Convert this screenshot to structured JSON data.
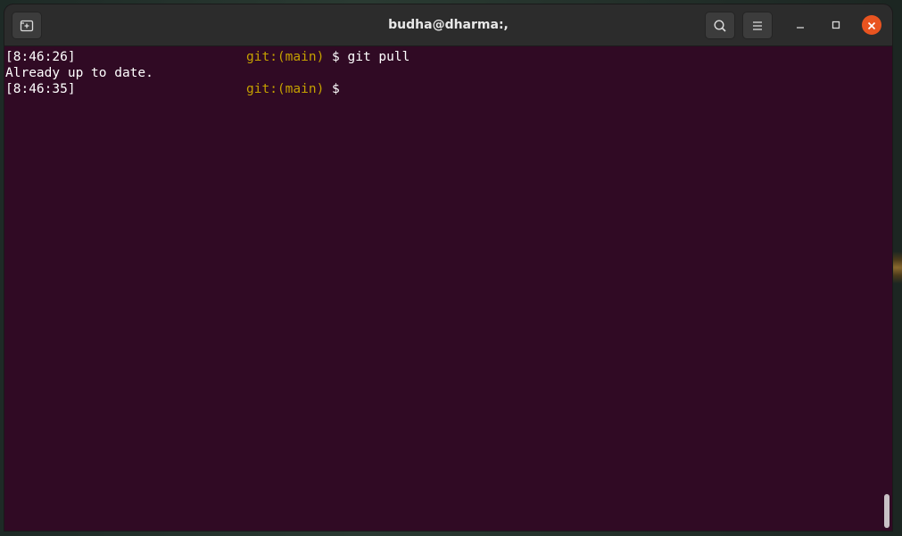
{
  "window": {
    "title": "budha@dharma:,",
    "buttons": {
      "new_tab": "new-tab-icon",
      "search": "search-icon",
      "menu": "hamburger-menu-icon",
      "minimize": "minimize-icon",
      "maximize": "maximize-icon",
      "close": "close-icon"
    },
    "colors": {
      "terminal_bg": "#300a24",
      "titlebar_bg": "#2c2c2c",
      "git_branch": "#c4a000",
      "close_button": "#e95420"
    }
  },
  "terminal": {
    "lines": [
      {
        "time": "[8:46:26]",
        "branch": "git:(main)",
        "command": " $ git pull"
      },
      {
        "output": "Already up to date."
      },
      {
        "time": "[8:46:35]",
        "branch": "git:(main)",
        "command": " $"
      }
    ]
  }
}
